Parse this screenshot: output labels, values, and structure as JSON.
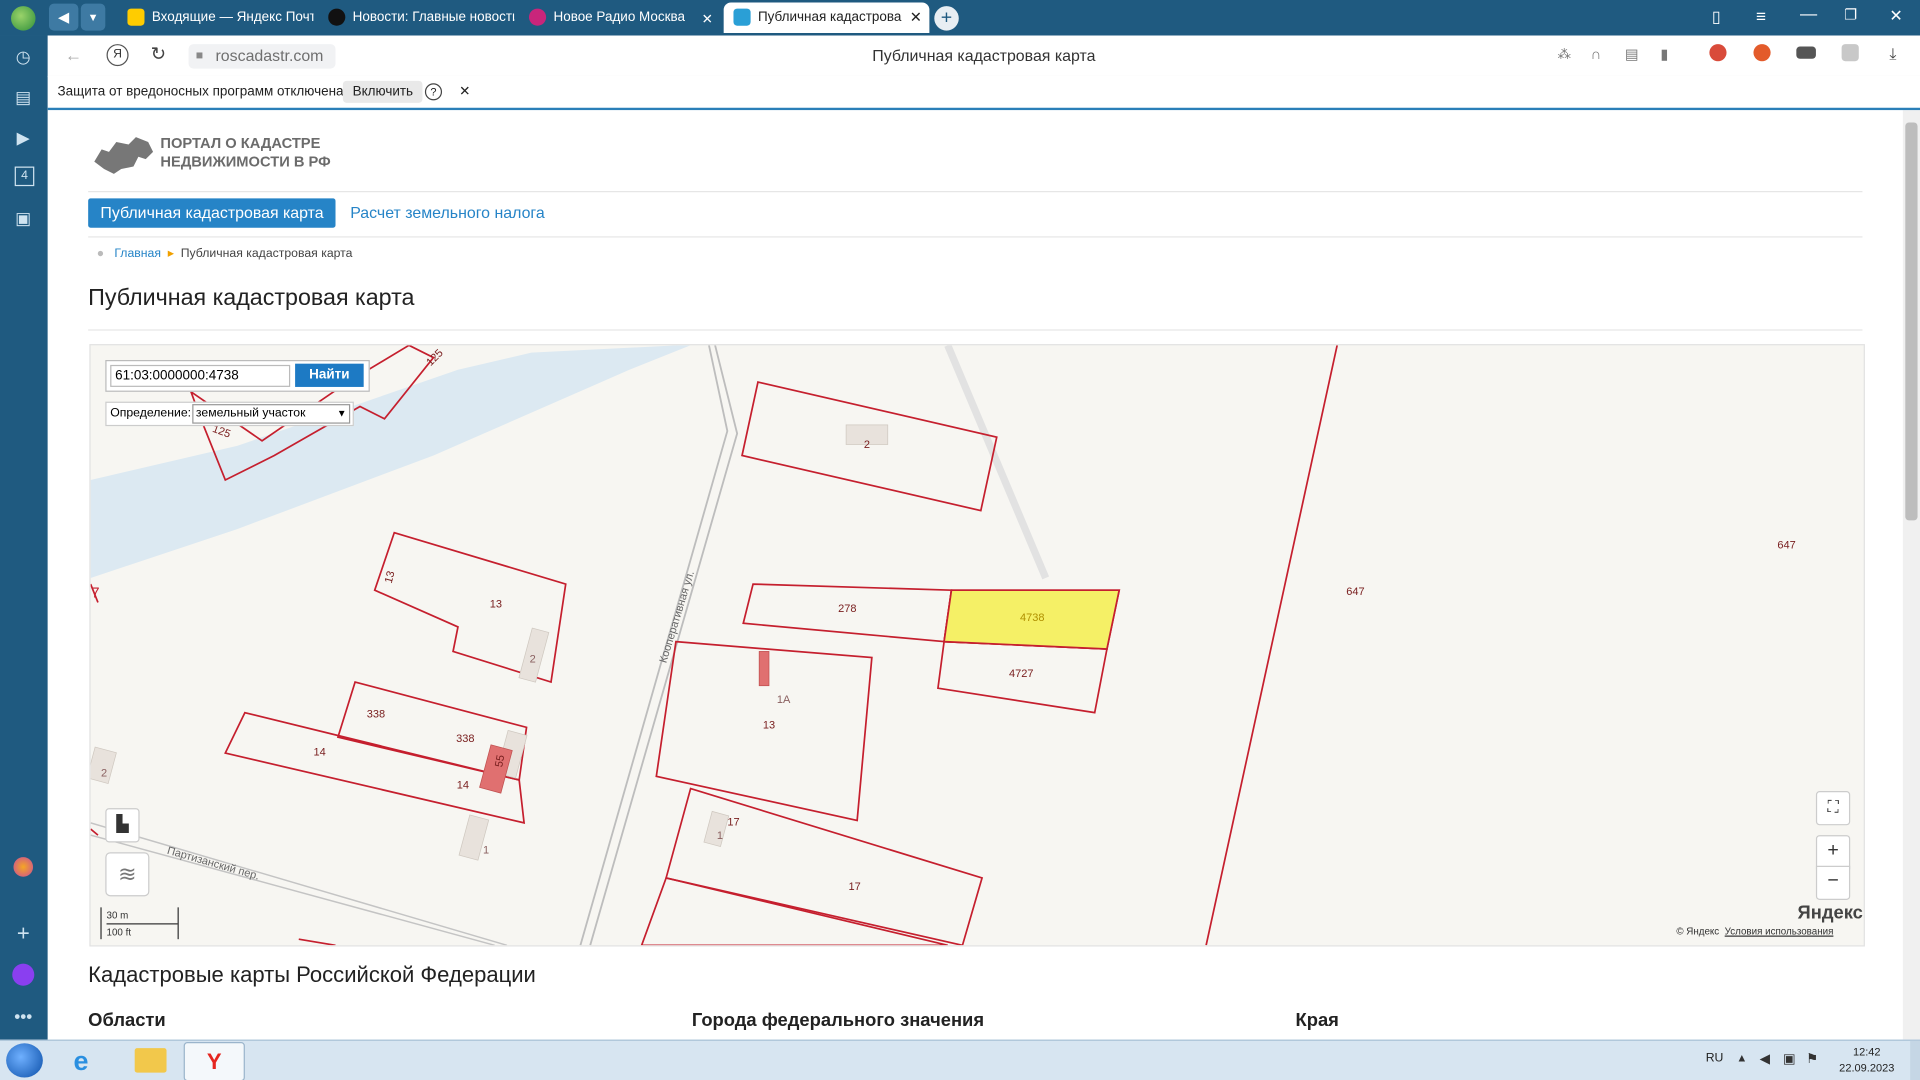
{
  "browser": {
    "tabs": [
      {
        "label": "Входящие — Яндекс Почта",
        "color": "#ffcc00"
      },
      {
        "label": "Новости: Главные новости",
        "color": "#222222"
      },
      {
        "label": "Новое Радио Москва",
        "color": "#c9257b"
      },
      {
        "label": "Публичная кадастрова",
        "color": "#2a9fd6"
      }
    ],
    "url": "roscadastr.com",
    "page_title": "Публичная кадастровая карта",
    "protection_msg": "Защита от вредоносных программ отключена",
    "enable_btn": "Включить",
    "help": "?"
  },
  "site": {
    "logo_line1": "ПОРТАЛ О КАДАСТРЕ",
    "logo_line2": "НЕДВИЖИМОСТИ В РФ",
    "nav_active": "Публичная кадастровая карта",
    "nav_link": "Расчет земельного налога",
    "breadcrumb_home": "Главная",
    "breadcrumb_current": "Публичная кадастровая карта",
    "heading": "Публичная кадастровая карта"
  },
  "map": {
    "search_value": "61:03:0000000:4738",
    "search_btn": "Найти",
    "def_label": "Определение:",
    "def_value": "земельный участок",
    "labels": {
      "p2": "2",
      "p4738": "4738",
      "p278": "278",
      "p4727": "4727",
      "p13a": "13",
      "p13b": "13",
      "p1A": "1А",
      "p13c": "13",
      "p338a": "338",
      "p338b": "338",
      "p14a": "14",
      "p14b": "14",
      "p17a": "17",
      "p17b": "17",
      "p647a": "647",
      "p647b": "647",
      "p125a": "125",
      "p125b": "125",
      "street1": "Кооперативная ул.",
      "street2": "Партизанский пер.",
      "b2": "2",
      "b2b": "2",
      "b1": "1",
      "b1b": "1",
      "n55": "55",
      "n7": "7"
    },
    "scale_m": "30 m",
    "scale_ft": "100 ft",
    "zoom_in": "+",
    "zoom_out": "−",
    "yandex": "Яндекс",
    "copyright": "© Яндекс",
    "terms": "Условия использования"
  },
  "sections": {
    "heading": "Кадастровые карты Российской Федерации",
    "col1": "Области",
    "col2": "Города федерального значения",
    "col3": "Края"
  },
  "taskbar": {
    "lang": "RU",
    "time": "12:42",
    "date": "22.09.2023"
  }
}
